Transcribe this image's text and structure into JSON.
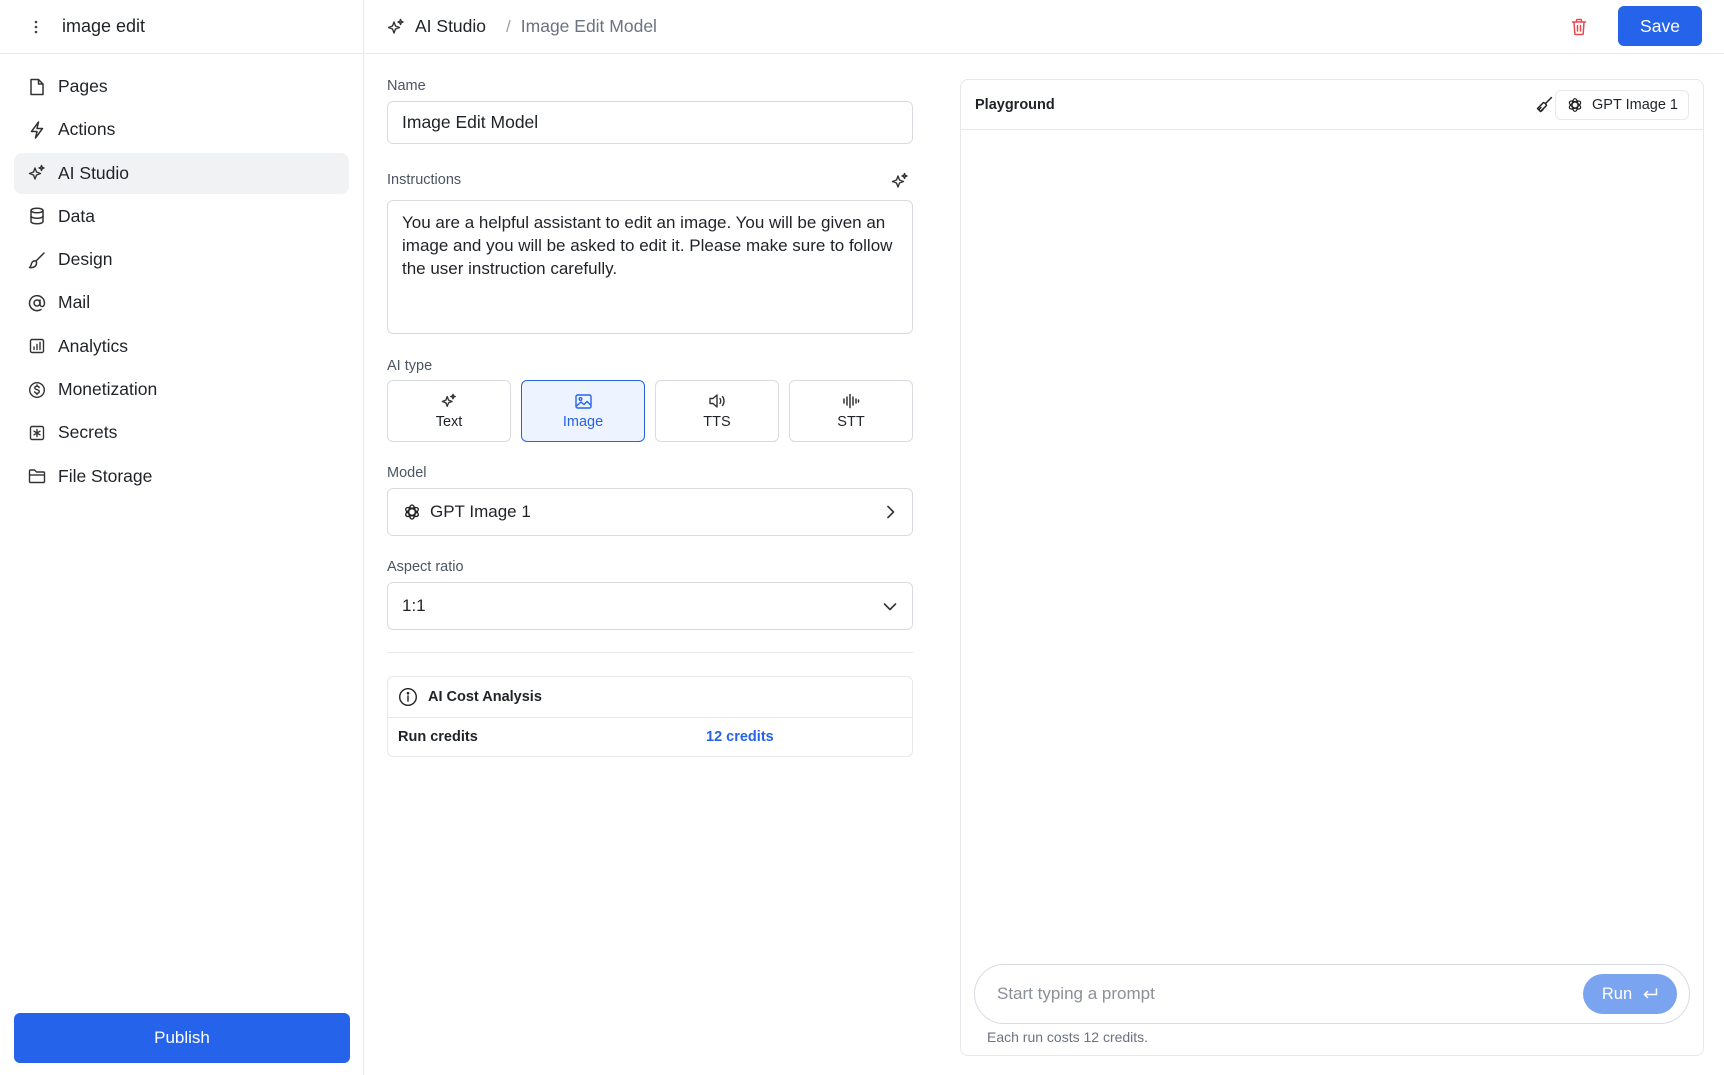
{
  "sidebar": {
    "project_name": "image edit",
    "items": [
      {
        "label": "Pages",
        "icon": "file-icon"
      },
      {
        "label": "Actions",
        "icon": "bolt-icon"
      },
      {
        "label": "AI Studio",
        "icon": "sparkles-icon",
        "active": true
      },
      {
        "label": "Data",
        "icon": "database-icon"
      },
      {
        "label": "Design",
        "icon": "brush-icon"
      },
      {
        "label": "Mail",
        "icon": "at-icon"
      },
      {
        "label": "Analytics",
        "icon": "chart-icon"
      },
      {
        "label": "Monetization",
        "icon": "dollar-circle-icon"
      },
      {
        "label": "Secrets",
        "icon": "asterisk-box-icon"
      },
      {
        "label": "File Storage",
        "icon": "folder-icon"
      }
    ],
    "publish_label": "Publish"
  },
  "header": {
    "breadcrumb_root": "AI Studio",
    "breadcrumb_separator": "/",
    "breadcrumb_current": "Image Edit Model",
    "save_label": "Save"
  },
  "form": {
    "name_label": "Name",
    "name_value": "Image Edit Model",
    "instructions_label": "Instructions",
    "instructions_value": "You are a helpful assistant to edit an image. You will be given an image and you will be asked to edit it. Please make sure to follow the user instruction carefully.",
    "ai_type_label": "AI type",
    "ai_types": [
      {
        "label": "Text",
        "icon": "sparkles-icon"
      },
      {
        "label": "Image",
        "icon": "image-icon",
        "active": true
      },
      {
        "label": "TTS",
        "icon": "speaker-icon"
      },
      {
        "label": "STT",
        "icon": "waveform-icon"
      }
    ],
    "model_label": "Model",
    "model_value": "GPT Image 1",
    "aspect_label": "Aspect ratio",
    "aspect_value": "1:1",
    "cost": {
      "title": "AI Cost Analysis",
      "run_credits_label": "Run credits",
      "run_credits_value": "12 credits"
    }
  },
  "playground": {
    "title": "Playground",
    "model_label": "GPT Image 1",
    "prompt_placeholder": "Start typing a prompt",
    "run_label": "Run",
    "note": "Each run costs 12 credits."
  },
  "colors": {
    "accent": "#2563eb",
    "run_button": "#7aa4ef",
    "danger": "#e5484d",
    "active_nav_bg": "#f1f2f4"
  }
}
